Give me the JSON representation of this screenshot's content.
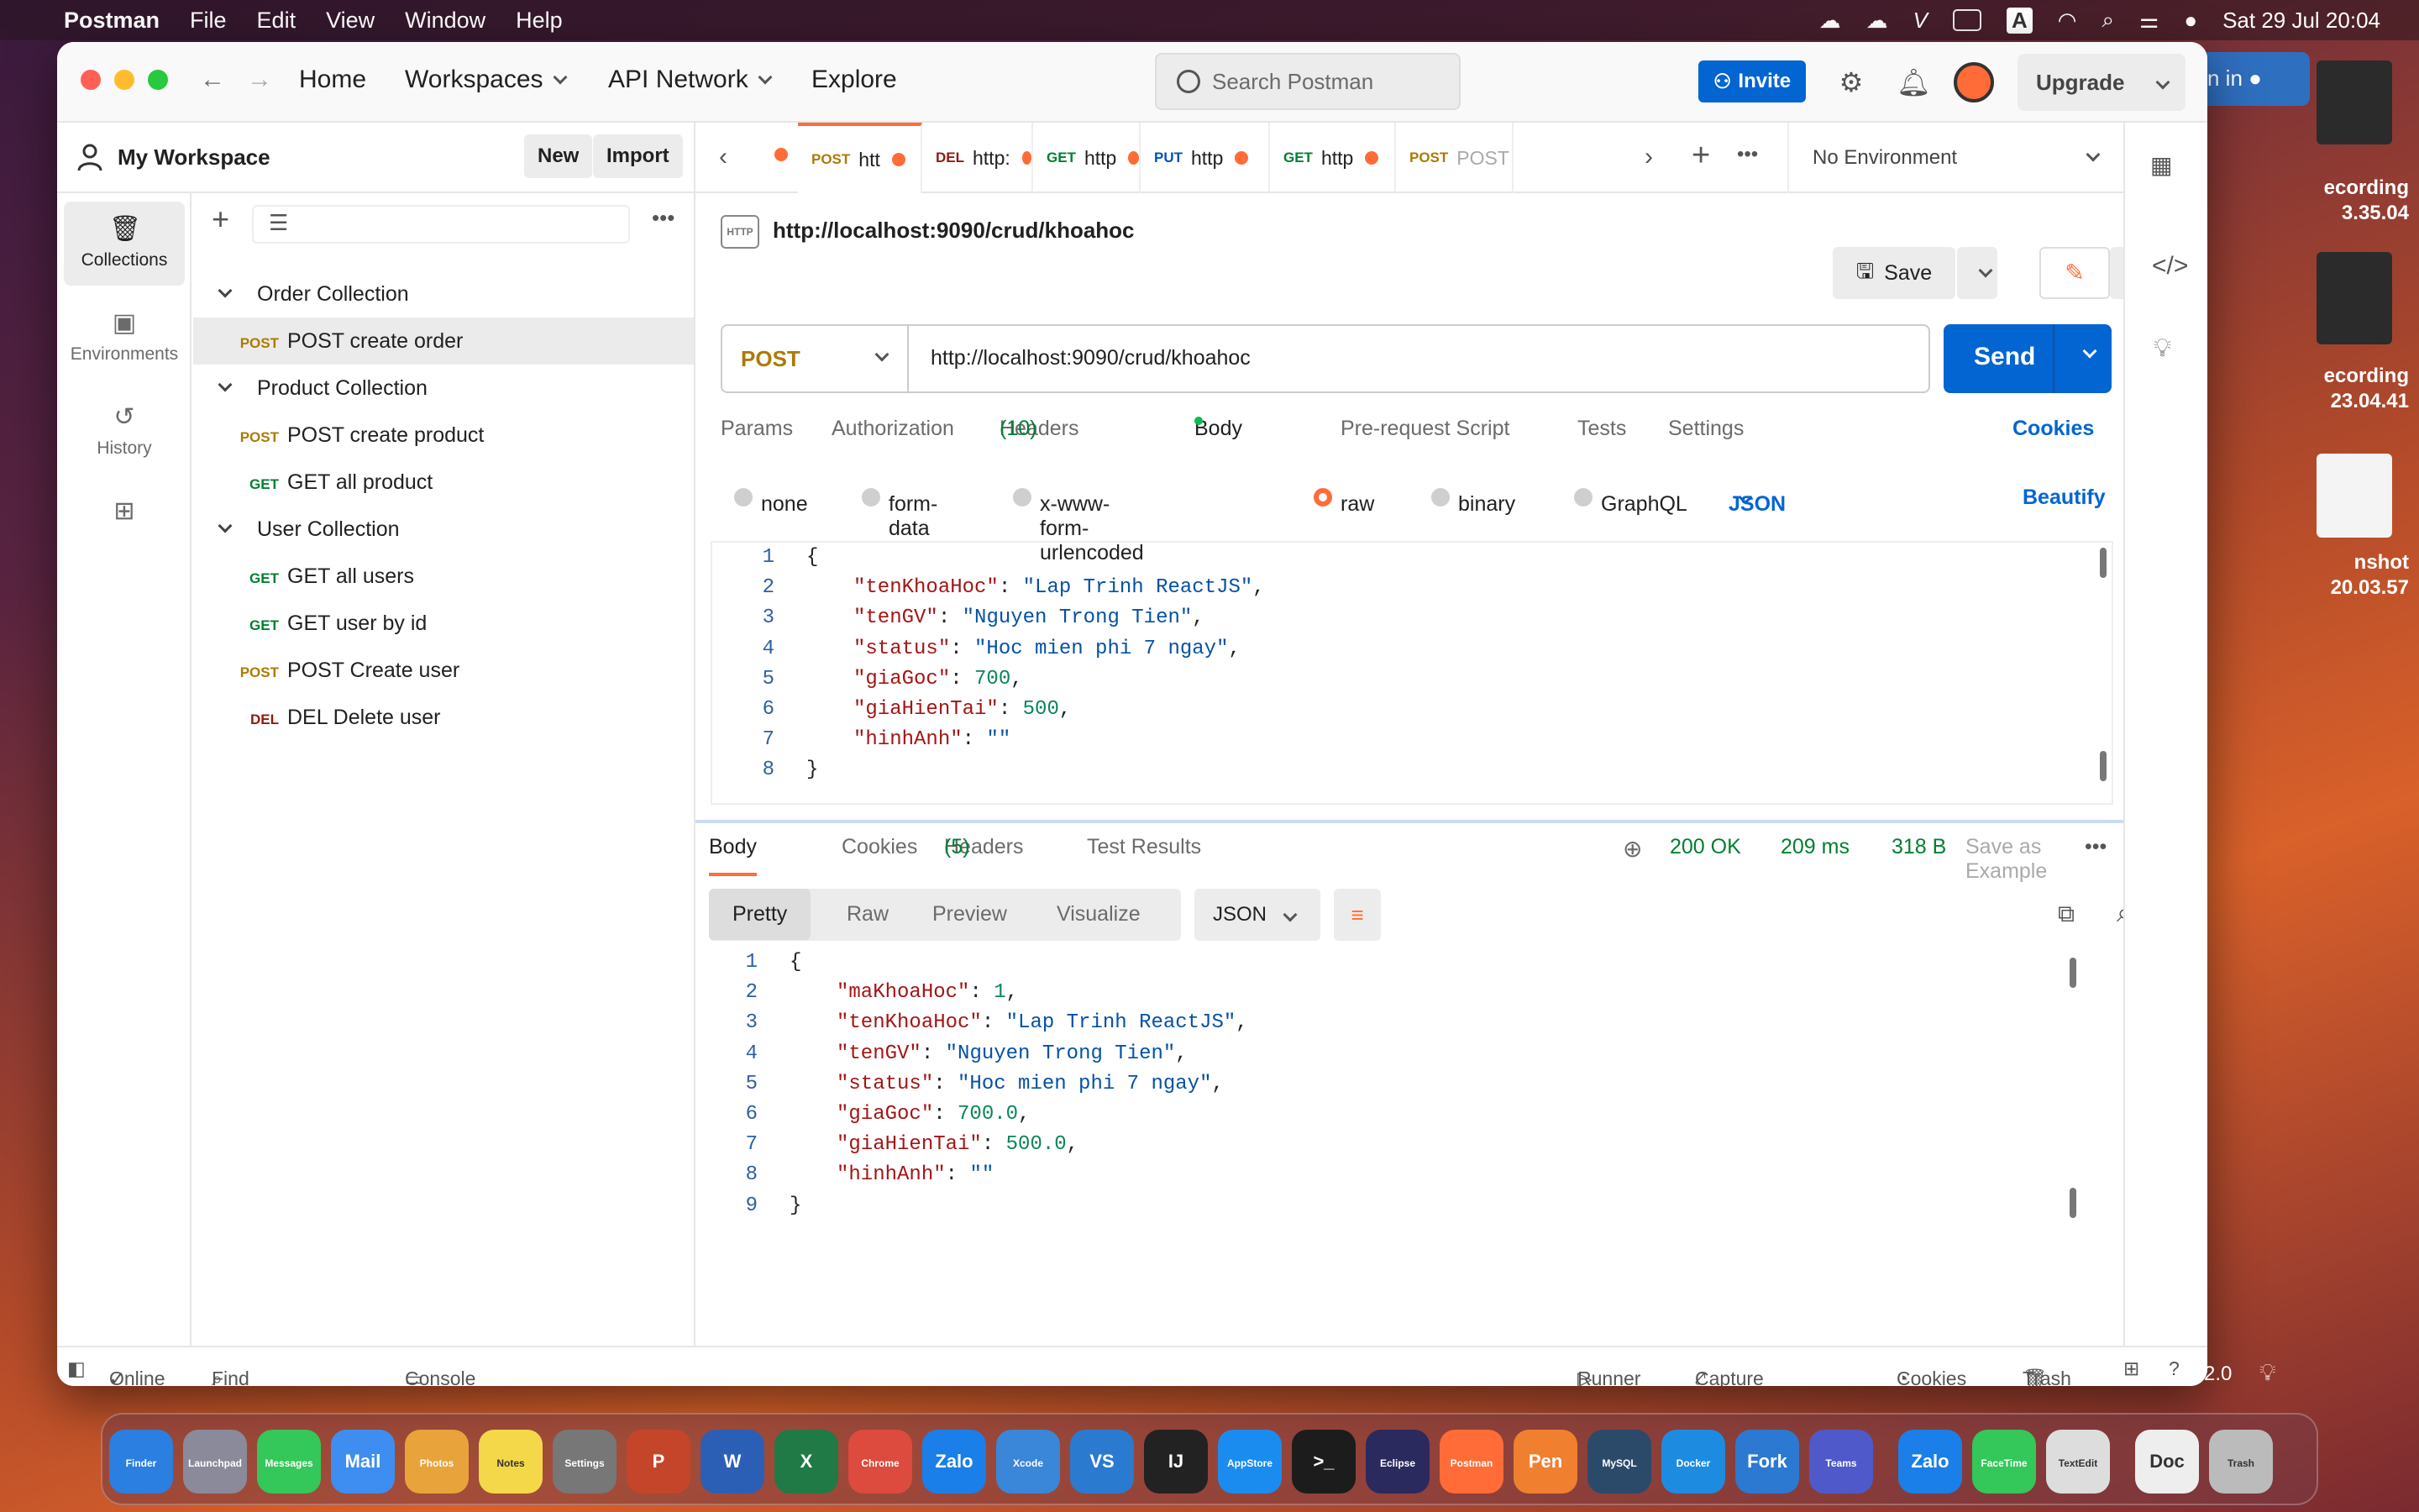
{
  "menubar": {
    "app": "Postman",
    "items": [
      "File",
      "Edit",
      "View",
      "Window",
      "Help"
    ],
    "datetime": "Sat 29 Jul  20:04",
    "input_source": "A"
  },
  "desktop": {
    "items": [
      "ecording",
      "3.35.04",
      "ecording",
      "23.04.41",
      "nshot",
      "20.03.57"
    ],
    "signin": "n in"
  },
  "titlebar": {
    "home": "Home",
    "workspaces": "Workspaces",
    "api_network": "API Network",
    "explore": "Explore",
    "search_placeholder": "Search Postman",
    "invite": "Invite",
    "upgrade": "Upgrade"
  },
  "workspace": {
    "title": "My Workspace",
    "new": "New",
    "import": "Import"
  },
  "rail": [
    {
      "label": "Collections",
      "icon": "collections-icon"
    },
    {
      "label": "Environments",
      "icon": "environments-icon"
    },
    {
      "label": "History",
      "icon": "history-icon"
    }
  ],
  "tree": [
    {
      "type": "folder",
      "label": "Order Collection"
    },
    {
      "type": "req",
      "method": "POST",
      "label": "POST create order",
      "selected": true
    },
    {
      "type": "folder",
      "label": "Product Collection"
    },
    {
      "type": "req",
      "method": "POST",
      "label": "POST create product"
    },
    {
      "type": "req",
      "method": "GET",
      "label": "GET all product"
    },
    {
      "type": "folder",
      "label": "User Collection"
    },
    {
      "type": "req",
      "method": "GET",
      "label": "GET all users"
    },
    {
      "type": "req",
      "method": "GET",
      "label": "GET user by id"
    },
    {
      "type": "req",
      "method": "POST",
      "label": "POST Create user"
    },
    {
      "type": "req",
      "method": "DEL",
      "label": "DEL Delete user"
    }
  ],
  "tabs": [
    {
      "method": "POST",
      "label": "htt"
    },
    {
      "method": "DEL",
      "label": "http:"
    },
    {
      "method": "GET",
      "label": "http"
    },
    {
      "method": "PUT",
      "label": "http"
    },
    {
      "method": "GET",
      "label": "http"
    },
    {
      "method": "POST",
      "label": "POST"
    }
  ],
  "environment": "No Environment",
  "request": {
    "title": "http://localhost:9090/crud/khoahoc",
    "save": "Save",
    "method": "POST",
    "url": "http://localhost:9090/crud/khoahoc",
    "send": "Send",
    "tabs": {
      "params": "Params",
      "auth": "Authorization",
      "headers": "Headers",
      "headers_count": "(10)",
      "body": "Body",
      "prereq": "Pre-request Script",
      "tests": "Tests",
      "settings": "Settings",
      "cookies": "Cookies"
    },
    "body_types": [
      "none",
      "form-data",
      "x-www-form-urlencoded",
      "raw",
      "binary",
      "GraphQL"
    ],
    "format": "JSON",
    "beautify": "Beautify",
    "body_lines": [
      {
        "n": "1",
        "text": "{"
      },
      {
        "n": "2",
        "key": "\"tenKhoaHoc\"",
        "val": "\"Lap Trinh ReactJS\"",
        "kind": "s",
        "comma": ","
      },
      {
        "n": "3",
        "key": "\"tenGV\"",
        "val": "\"Nguyen Trong Tien\"",
        "kind": "s",
        "comma": ","
      },
      {
        "n": "4",
        "key": "\"status\"",
        "val": "\"Hoc mien phi 7 ngay\"",
        "kind": "s",
        "comma": ","
      },
      {
        "n": "5",
        "key": "\"giaGoc\"",
        "val": "700",
        "kind": "n",
        "comma": ","
      },
      {
        "n": "6",
        "key": "\"giaHienTai\"",
        "val": "500",
        "kind": "n",
        "comma": ","
      },
      {
        "n": "7",
        "key": "\"hinhAnh\"",
        "val": "\"\"",
        "kind": "s",
        "comma": ""
      },
      {
        "n": "8",
        "text": "}"
      }
    ]
  },
  "response": {
    "tabs": {
      "body": "Body",
      "cookies": "Cookies",
      "headers": "Headers",
      "headers_count": "(5)",
      "tests": "Test Results"
    },
    "status": "200 OK",
    "time": "209 ms",
    "size": "318 B",
    "save_example": "Save as Example",
    "views": [
      "Pretty",
      "Raw",
      "Preview",
      "Visualize"
    ],
    "format": "JSON",
    "lines": [
      {
        "n": "1",
        "text": "{"
      },
      {
        "n": "2",
        "key": "\"maKhoaHoc\"",
        "val": "1",
        "kind": "n",
        "comma": ","
      },
      {
        "n": "3",
        "key": "\"tenKhoaHoc\"",
        "val": "\"Lap Trinh ReactJS\"",
        "kind": "s",
        "comma": ","
      },
      {
        "n": "4",
        "key": "\"tenGV\"",
        "val": "\"Nguyen Trong Tien\"",
        "kind": "s",
        "comma": ","
      },
      {
        "n": "5",
        "key": "\"status\"",
        "val": "\"Hoc mien phi 7 ngay\"",
        "kind": "s",
        "comma": ","
      },
      {
        "n": "6",
        "key": "\"giaGoc\"",
        "val": "700.0",
        "kind": "n",
        "comma": ","
      },
      {
        "n": "7",
        "key": "\"giaHienTai\"",
        "val": "500.0",
        "kind": "n",
        "comma": ","
      },
      {
        "n": "8",
        "key": "\"hinhAnh\"",
        "val": "\"\"",
        "kind": "s",
        "comma": ""
      },
      {
        "n": "9",
        "text": "}"
      }
    ]
  },
  "footer": {
    "online": "Online",
    "find": "Find and replace",
    "console": "Console",
    "runner": "Runner",
    "capture": "Capture requests",
    "cookies": "Cookies",
    "trash": "Trash",
    "version": "2.0"
  },
  "dock": [
    {
      "label": "Finder",
      "color": "#2a7fe0"
    },
    {
      "label": "Launchpad",
      "color": "#8a8a9a"
    },
    {
      "label": "Messages",
      "color": "#34c759"
    },
    {
      "label": "Mail",
      "color": "#3d8ef0"
    },
    {
      "label": "Photos",
      "color": "#e8a33a"
    },
    {
      "label": "Notes",
      "color": "#f5d84a"
    },
    {
      "label": "Settings",
      "color": "#777"
    },
    {
      "label": "P",
      "color": "#c5452a"
    },
    {
      "label": "W",
      "color": "#2b5fb5"
    },
    {
      "label": "X",
      "color": "#1f7a45"
    },
    {
      "label": "Chrome",
      "color": "#dd4b3e"
    },
    {
      "label": "Zalo",
      "color": "#1a7fe8"
    },
    {
      "label": "Xcode",
      "color": "#3a86d8"
    },
    {
      "label": "VS",
      "color": "#2a7ad0"
    },
    {
      "label": "IJ",
      "color": "#222"
    },
    {
      "label": "AppStore",
      "color": "#1a8cf0"
    },
    {
      "label": ">_",
      "color": "#1c1c1c"
    },
    {
      "label": "Eclipse",
      "color": "#2b2a5e"
    },
    {
      "label": "Postman",
      "color": "#ff6c37"
    },
    {
      "label": "Pen",
      "color": "#f08030"
    },
    {
      "label": "MySQL",
      "color": "#2b4a6a"
    },
    {
      "label": "Docker",
      "color": "#1d8ce0"
    },
    {
      "label": "Fork",
      "color": "#2b79d0"
    },
    {
      "label": "Teams",
      "color": "#5059c9"
    },
    {
      "label": "Zalo",
      "color": "#1a7fe8"
    },
    {
      "label": "FaceTime",
      "color": "#34c759"
    },
    {
      "label": "TextEdit",
      "color": "#ddd"
    },
    {
      "label": "Doc",
      "color": "#eee"
    },
    {
      "label": "Trash",
      "color": "#bbb"
    }
  ]
}
